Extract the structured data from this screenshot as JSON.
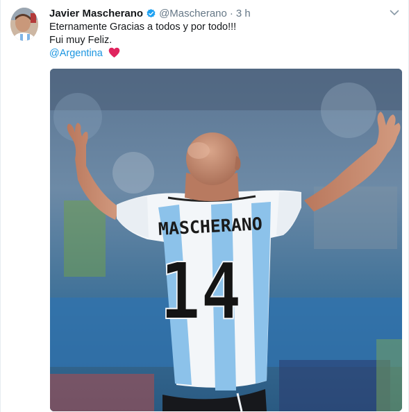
{
  "tweet": {
    "user": {
      "name": "Javier Mascherano",
      "handle": "@Mascherano",
      "separator": "·",
      "time": "3 h"
    },
    "lines": [
      "Eternamente Gracias a todos y por todo!!!",
      "Fui muy Feliz."
    ],
    "mention": "@Argentina",
    "jersey": {
      "name": "MASCHERANO",
      "number": "14"
    },
    "icons": {
      "verified": "verified-badge-icon",
      "heart": "red-heart-icon",
      "menu": "chevron-down-icon"
    },
    "colors": {
      "link": "#1b95e0",
      "heart": "#e0245e",
      "verified": "#1da1f2",
      "muted": "#657786"
    }
  }
}
